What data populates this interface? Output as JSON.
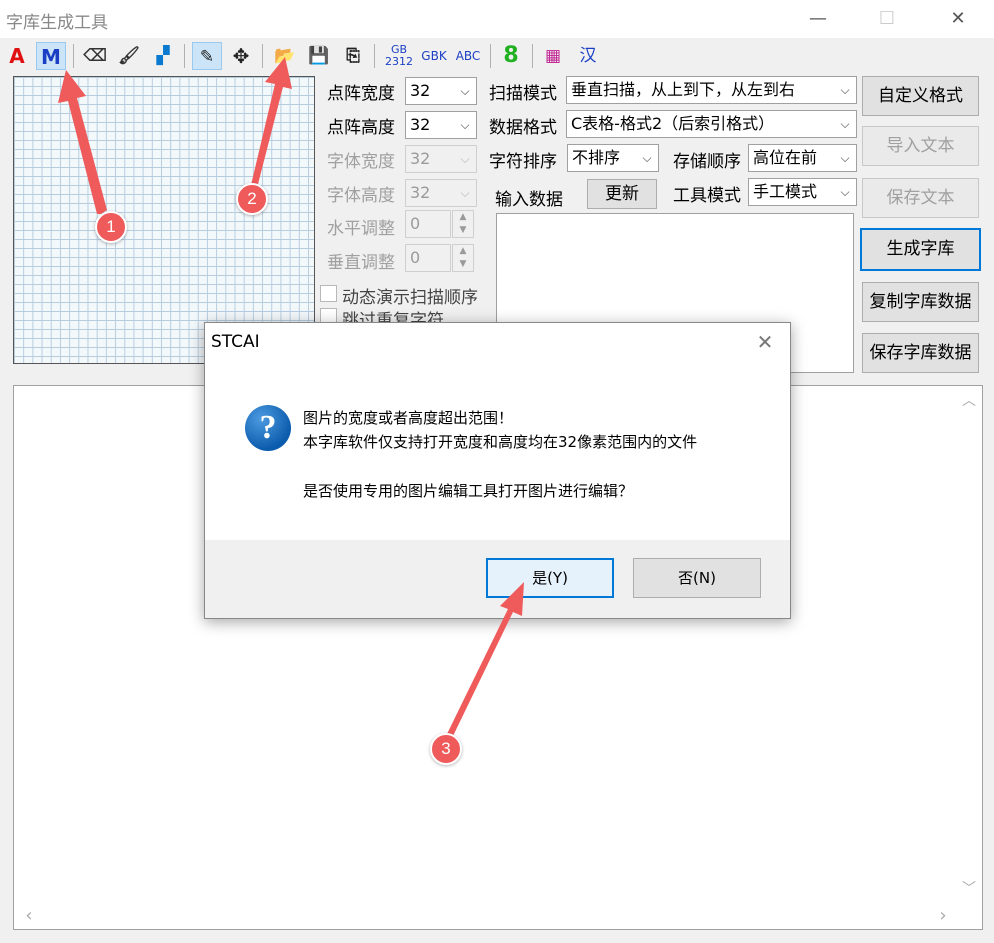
{
  "window": {
    "title": "字库生成工具",
    "minimize": "—",
    "maximize": "☐",
    "close": "✕"
  },
  "toolbar": {
    "text_mode": "A",
    "matrix_mode": "M",
    "eraser": "⌫",
    "fill": "🖌",
    "color": "▞",
    "pencil": "✎",
    "move": "✥",
    "open": "📂",
    "save": "💾",
    "save_all": "⎘",
    "gb2312_top": "GB",
    "gb2312_bottom": "2312",
    "gbk": "GBK",
    "abc": "ABC",
    "digit": "8",
    "palette": "▦",
    "hanzi": "汉"
  },
  "settings": {
    "matrix_width_label": "点阵宽度",
    "matrix_width_value": "32",
    "matrix_height_label": "点阵高度",
    "matrix_height_value": "32",
    "font_width_label": "字体宽度",
    "font_width_value": "32",
    "font_height_label": "字体高度",
    "font_height_value": "32",
    "h_adjust_label": "水平调整",
    "h_adjust_value": "0",
    "v_adjust_label": "垂直调整",
    "v_adjust_value": "0",
    "dynamic_scan_label": "动态演示扫描顺序",
    "skip_duplicate_label": "跳过重复字符",
    "scan_mode_label": "扫描模式",
    "scan_mode_value": "垂直扫描，从上到下，从左到右",
    "data_format_label": "数据格式",
    "data_format_value": "C表格-格式2（后索引格式）",
    "char_sort_label": "字符排序",
    "char_sort_value": "不排序",
    "storage_order_label": "存储顺序",
    "storage_order_value": "高位在前",
    "input_data_label": "输入数据",
    "update_button": "更新",
    "tool_mode_label": "工具模式",
    "tool_mode_value": "手工模式",
    "spin_up": "▲",
    "spin_down": "▼",
    "combo_arrow": "⌵"
  },
  "right_buttons": {
    "custom_format": "自定义格式",
    "import_text": "导入文本",
    "save_text": "保存文本",
    "generate_font": "生成字库",
    "copy_font_data": "复制字库数据",
    "save_font_data": "保存字库数据"
  },
  "scroll": {
    "up": "︿",
    "down": "﹀",
    "left": "‹",
    "right": "›"
  },
  "dialog": {
    "title": "STCAI",
    "close": "✕",
    "icon": "?",
    "line1": "图片的宽度或者高度超出范围！",
    "line2": "本字库软件仅支持打开宽度和高度均在32像素范围内的文件",
    "line3": "是否使用专用的图片编辑工具打开图片进行编辑？",
    "yes_button": "是(Y)",
    "no_button": "否(N)"
  },
  "annotations": {
    "badge1": "1",
    "badge2": "2",
    "badge3": "3",
    "color": "#ef5a5a"
  }
}
